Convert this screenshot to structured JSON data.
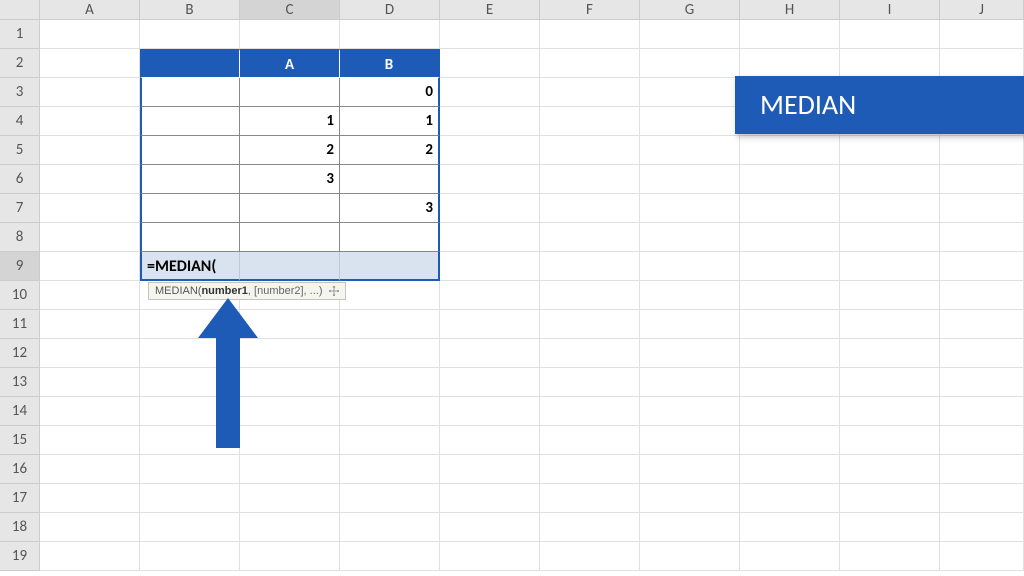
{
  "columns": [
    "A",
    "B",
    "C",
    "D",
    "E",
    "F",
    "G",
    "H",
    "I",
    "J"
  ],
  "rows": [
    "1",
    "2",
    "3",
    "4",
    "5",
    "6",
    "7",
    "8",
    "9",
    "10",
    "11",
    "12",
    "13",
    "14",
    "15",
    "16",
    "17",
    "18",
    "19"
  ],
  "selectedCol": "C",
  "selectedRow": "9",
  "table": {
    "headerA": "A",
    "headerB": "B",
    "r3": {
      "c": "",
      "d": "0"
    },
    "r4": {
      "c": "1",
      "d": "1"
    },
    "r5": {
      "c": "2",
      "d": "2"
    },
    "r6": {
      "c": "3",
      "d": ""
    },
    "r7": {
      "c": "",
      "d": "3"
    },
    "r8": {
      "c": "",
      "d": ""
    }
  },
  "formula": "=MEDIAN(",
  "tooltip": {
    "func": "MEDIAN(",
    "arg1": "number1",
    "rest": ", [number2], ...)"
  },
  "banner": "MEDIAN"
}
